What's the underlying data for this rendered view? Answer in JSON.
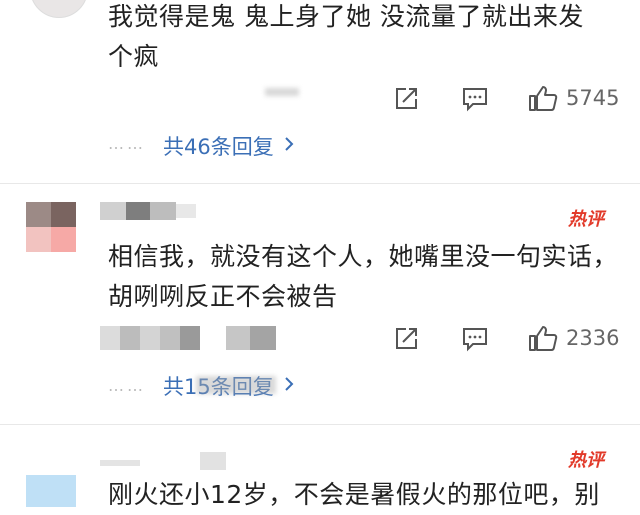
{
  "comments": [
    {
      "text_line1": "我觉得是鬼  鬼上身了她 没流量了就出来发",
      "text_line2": "个疯",
      "likes": "5745",
      "replies": "共46条回复",
      "dots": "……"
    },
    {
      "hot_badge": "热评",
      "text_line1": "相信我，就没有这个人，她嘴里没一句实话，",
      "text_line2": "胡咧咧反正不会被告",
      "likes": "2336",
      "replies": "共15条回复",
      "dots": "……"
    },
    {
      "hot_badge": "热评",
      "text_line1": "刚火还小12岁，不会是暑假火的那位吧，别"
    }
  ],
  "icons": {
    "share": "share-icon",
    "comment": "comment-icon",
    "like": "thumbs-up-icon",
    "chevron": "chevron-right-icon"
  },
  "colors": {
    "link_blue": "#3b6fb6",
    "hot_red": "#e23a2a",
    "text": "#222222",
    "muted": "#666666"
  }
}
